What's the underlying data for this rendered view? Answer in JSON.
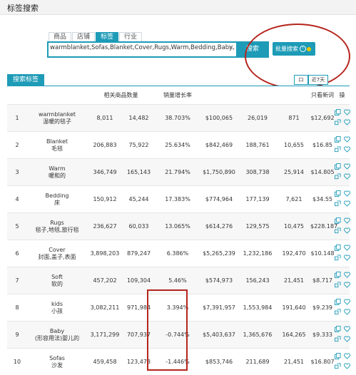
{
  "header": {
    "title": "标签搜索"
  },
  "tabs": [
    {
      "label": "商品",
      "active": false
    },
    {
      "label": "店铺",
      "active": false
    },
    {
      "label": "标签",
      "active": true
    },
    {
      "label": "行业",
      "active": false
    }
  ],
  "search": {
    "value": "warmblanket,Sofas,Blanket,Cover,Rugs,Warm,Bedding,Baby,",
    "clear_icon": "close-icon",
    "button_label": "搜索",
    "batch_label": "批量搜索"
  },
  "section": {
    "label": "搜索标签",
    "range_short": "口",
    "range_week": "近7天"
  },
  "table": {
    "headers": {
      "index": "",
      "keyword": "",
      "related": "相关商品数量",
      "col3": "",
      "growth": "销量增长率",
      "col5": "",
      "col6": "",
      "col7": "",
      "newword": "只看新词",
      "ops": "操"
    },
    "rows": [
      {
        "idx": "1",
        "en": "warmblanket",
        "zh": "温暖的毯子",
        "c1": "8,011",
        "c2": "14,482",
        "growth": "38.703%",
        "trend": "up",
        "c4": "$100,065",
        "c5": "26,019",
        "c6": "871",
        "c7": "$12,692"
      },
      {
        "idx": "2",
        "en": "Blanket",
        "zh": "毛毯",
        "c1": "206,883",
        "c2": "75,922",
        "growth": "25.634%",
        "trend": "up",
        "c4": "$842,469",
        "c5": "188,761",
        "c6": "10,655",
        "c7": "$16.85"
      },
      {
        "idx": "3",
        "en": "Warm",
        "zh": "暖和的",
        "c1": "346,749",
        "c2": "165,143",
        "growth": "21.794%",
        "trend": "up",
        "c4": "$1,750,890",
        "c5": "308,738",
        "c6": "25,914",
        "c7": "$14.805"
      },
      {
        "idx": "4",
        "en": "Bedding",
        "zh": "床",
        "c1": "150,912",
        "c2": "45,244",
        "growth": "17.383%",
        "trend": "up",
        "c4": "$774,964",
        "c5": "177,139",
        "c6": "7,621",
        "c7": "$34.55"
      },
      {
        "idx": "5",
        "en": "Rugs",
        "zh": "毯子,地毯,旅行毯",
        "c1": "236,627",
        "c2": "60,033",
        "growth": "13.065%",
        "trend": "up",
        "c4": "$614,276",
        "c5": "129,575",
        "c6": "10,475",
        "c7": "$228.187"
      },
      {
        "idx": "6",
        "en": "Cover",
        "zh": "封面,盖子,表面",
        "c1": "3,898,203",
        "c2": "879,247",
        "growth": "6.386%",
        "trend": "up",
        "c4": "$5,265,239",
        "c5": "1,232,186",
        "c6": "192,470",
        "c7": "$10.148"
      },
      {
        "idx": "7",
        "en": "Soft",
        "zh": "软的",
        "c1": "457,202",
        "c2": "109,304",
        "growth": "5.46%",
        "trend": "up",
        "c4": "$574,973",
        "c5": "156,243",
        "c6": "21,451",
        "c7": "$8.717"
      },
      {
        "idx": "8",
        "en": "kids",
        "zh": "小孩",
        "c1": "3,082,211",
        "c2": "971,984",
        "growth": "3.394%",
        "trend": "up",
        "c4": "$7,391,957",
        "c5": "1,553,984",
        "c6": "191,640",
        "c7": "$9.239"
      },
      {
        "idx": "9",
        "en": "Baby",
        "zh": "(形容用法)婴儿的",
        "c1": "3,171,299",
        "c2": "707,937",
        "growth": "-0.744%",
        "trend": "down",
        "c4": "$5,403,637",
        "c5": "1,365,676",
        "c6": "164,265",
        "c7": "$9.333"
      },
      {
        "idx": "10",
        "en": "Sofas",
        "zh": "沙发",
        "c1": "459,458",
        "c2": "123,473",
        "growth": "-1.446%",
        "trend": "down",
        "c4": "$853,746",
        "c5": "211,689",
        "c6": "21,451",
        "c7": "$16.807"
      }
    ]
  },
  "colors": {
    "accent": "#1d9bb7",
    "positive": "#e8862a",
    "negative": "#3a9b3a",
    "highlight": "#b5251c"
  },
  "icons": [
    "copy-icon",
    "heart-icon",
    "link-icon"
  ]
}
